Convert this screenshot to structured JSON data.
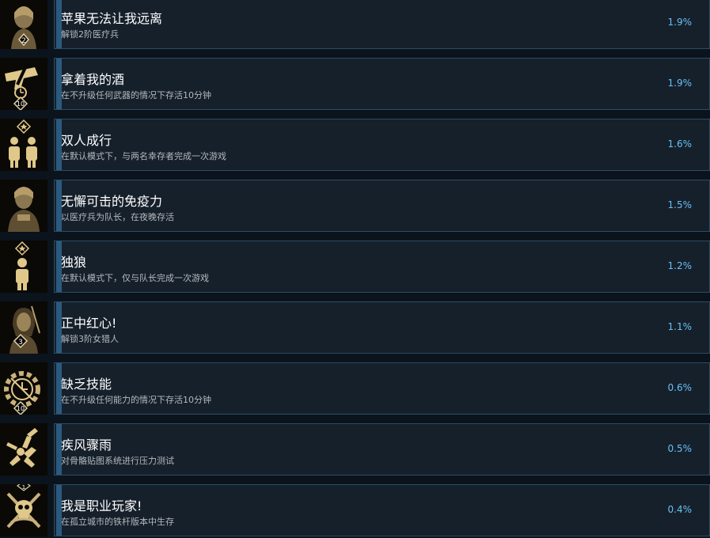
{
  "achievements": [
    {
      "icon": "medic-portrait-icon",
      "title": "苹果无法让我远离",
      "desc": "解锁2阶医疗兵",
      "percent": "1.9%",
      "badge": "2"
    },
    {
      "icon": "gun-clock-icon",
      "title": "拿着我的酒",
      "desc": "在不升级任何武器的情况下存活10分钟",
      "percent": "1.9%",
      "badge": "10"
    },
    {
      "icon": "two-survivors-icon",
      "title": "双人成行",
      "desc": "在默认模式下，与两名幸存者完成一次游戏",
      "percent": "1.6%",
      "badge": ""
    },
    {
      "icon": "medic-leader-portrait-icon",
      "title": "无懈可击的免疫力",
      "desc": "以医疗兵为队长，在夜晚存活",
      "percent": "1.5%",
      "badge": ""
    },
    {
      "icon": "lone-wolf-icon",
      "title": "独狼",
      "desc": "在默认模式下，仅与队长完成一次游戏",
      "percent": "1.2%",
      "badge": ""
    },
    {
      "icon": "huntress-portrait-icon",
      "title": "正中红心!",
      "desc": "解锁3阶女猎人",
      "percent": "1.1%",
      "badge": "3"
    },
    {
      "icon": "gear-clock-icon",
      "title": "缺乏技能",
      "desc": "在不升级任何能力的情况下存活10分钟",
      "percent": "0.6%",
      "badge": "10"
    },
    {
      "icon": "ragdoll-figure-icon",
      "title": "疾风骤雨",
      "desc": "对骨骼贴图系统进行压力测试",
      "percent": "0.5%",
      "badge": ""
    },
    {
      "icon": "skull-crossbones-icon",
      "title": "我是职业玩家!",
      "desc": "在孤立城市的铁杆版本中生存",
      "percent": "0.4%",
      "badge": "1"
    }
  ],
  "colors": {
    "gold": "#c9b17a",
    "panel": "#16202b",
    "border": "#2b4d63",
    "accent": "#66c0f4",
    "bar": "#2b5a80"
  }
}
